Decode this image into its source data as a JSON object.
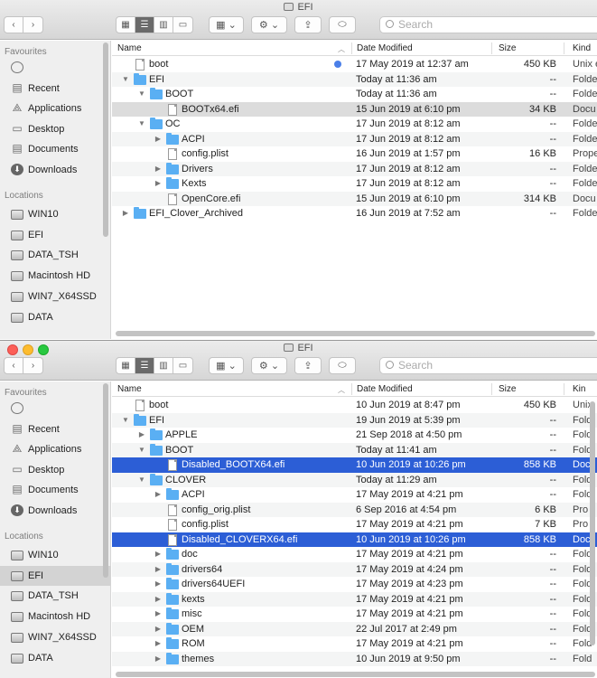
{
  "window1": {
    "title": "EFI",
    "search_placeholder": "Search",
    "sidebar": {
      "favourites_header": "Favourites",
      "favourites": [
        {
          "label": "",
          "icon": "airdrop-icon"
        },
        {
          "label": "Recent",
          "icon": "recent-icon"
        },
        {
          "label": "Applications",
          "icon": "applications-icon"
        },
        {
          "label": "Desktop",
          "icon": "desktop-icon"
        },
        {
          "label": "Documents",
          "icon": "documents-icon"
        },
        {
          "label": "Downloads",
          "icon": "downloads-icon"
        }
      ],
      "locations_header": "Locations",
      "locations": [
        {
          "label": "WIN10",
          "icon": "disk-icon"
        },
        {
          "label": "EFI",
          "icon": "disk-icon"
        },
        {
          "label": "DATA_TSH",
          "icon": "disk-icon"
        },
        {
          "label": "Macintosh HD",
          "icon": "disk-icon"
        },
        {
          "label": "WIN7_X64SSD",
          "icon": "disk-icon"
        },
        {
          "label": "DATA",
          "icon": "disk-icon"
        }
      ]
    },
    "columns": {
      "name": "Name",
      "date": "Date Modified",
      "size": "Size",
      "kind": "Kind"
    },
    "rows": [
      {
        "name": "boot",
        "date": "17 May 2019 at 12:37 am",
        "size": "450 KB",
        "kind": "Unix e",
        "depth": 0,
        "type": "file",
        "disc": "",
        "tag": true
      },
      {
        "name": "EFI",
        "date": "Today at 11:36 am",
        "size": "--",
        "kind": "Folde",
        "depth": 0,
        "type": "folder",
        "disc": "▼"
      },
      {
        "name": "BOOT",
        "date": "Today at 11:36 am",
        "size": "--",
        "kind": "Folde",
        "depth": 1,
        "type": "folder",
        "disc": "▼"
      },
      {
        "name": "BOOTx64.efi",
        "date": "15 Jun 2019 at 6:10 pm",
        "size": "34 KB",
        "kind": "Docu",
        "depth": 2,
        "type": "file",
        "disc": "",
        "selected": "grey"
      },
      {
        "name": "OC",
        "date": "17 Jun 2019 at 8:12 am",
        "size": "--",
        "kind": "Folde",
        "depth": 1,
        "type": "folder",
        "disc": "▼"
      },
      {
        "name": "ACPI",
        "date": "17 Jun 2019 at 8:12 am",
        "size": "--",
        "kind": "Folde",
        "depth": 2,
        "type": "folder",
        "disc": "▶"
      },
      {
        "name": "config.plist",
        "date": "16 Jun 2019 at 1:57 pm",
        "size": "16 KB",
        "kind": "Prope",
        "depth": 2,
        "type": "file",
        "disc": ""
      },
      {
        "name": "Drivers",
        "date": "17 Jun 2019 at 8:12 am",
        "size": "--",
        "kind": "Folde",
        "depth": 2,
        "type": "folder",
        "disc": "▶"
      },
      {
        "name": "Kexts",
        "date": "17 Jun 2019 at 8:12 am",
        "size": "--",
        "kind": "Folde",
        "depth": 2,
        "type": "folder",
        "disc": "▶"
      },
      {
        "name": "OpenCore.efi",
        "date": "15 Jun 2019 at 6:10 pm",
        "size": "314 KB",
        "kind": "Docu",
        "depth": 2,
        "type": "file",
        "disc": ""
      },
      {
        "name": "EFI_Clover_Archived",
        "date": "16 Jun 2019 at 7:52 am",
        "size": "--",
        "kind": "Folde",
        "depth": 0,
        "type": "folder",
        "disc": "▶"
      }
    ]
  },
  "window2": {
    "title": "EFI",
    "search_placeholder": "Search",
    "sidebar": {
      "favourites_header": "Favourites",
      "favourites": [
        {
          "label": "",
          "icon": "airdrop-icon"
        },
        {
          "label": "Recent",
          "icon": "recent-icon"
        },
        {
          "label": "Applications",
          "icon": "applications-icon"
        },
        {
          "label": "Desktop",
          "icon": "desktop-icon"
        },
        {
          "label": "Documents",
          "icon": "documents-icon"
        },
        {
          "label": "Downloads",
          "icon": "downloads-icon"
        }
      ],
      "locations_header": "Locations",
      "locations": [
        {
          "label": "WIN10",
          "icon": "disk-icon"
        },
        {
          "label": "EFI",
          "icon": "disk-icon",
          "selected": true
        },
        {
          "label": "DATA_TSH",
          "icon": "disk-icon"
        },
        {
          "label": "Macintosh HD",
          "icon": "disk-icon"
        },
        {
          "label": "WIN7_X64SSD",
          "icon": "disk-icon"
        },
        {
          "label": "DATA",
          "icon": "disk-icon"
        }
      ]
    },
    "columns": {
      "name": "Name",
      "date": "Date Modified",
      "size": "Size",
      "kind": "Kin"
    },
    "rows": [
      {
        "name": "boot",
        "date": "10 Jun 2019 at 8:47 pm",
        "size": "450 KB",
        "kind": "Unix",
        "depth": 0,
        "type": "file",
        "disc": ""
      },
      {
        "name": "EFI",
        "date": "19 Jun 2019 at 5:39 pm",
        "size": "--",
        "kind": "Fold",
        "depth": 0,
        "type": "folder",
        "disc": "▼"
      },
      {
        "name": "APPLE",
        "date": "21 Sep 2018 at 4:50 pm",
        "size": "--",
        "kind": "Fold",
        "depth": 1,
        "type": "folder",
        "disc": "▶"
      },
      {
        "name": "BOOT",
        "date": "Today at 11:41 am",
        "size": "--",
        "kind": "Fold",
        "depth": 1,
        "type": "folder",
        "disc": "▼"
      },
      {
        "name": "Disabled_BOOTX64.efi",
        "date": "10 Jun 2019 at 10:26 pm",
        "size": "858 KB",
        "kind": "Doc",
        "depth": 2,
        "type": "file",
        "disc": "",
        "selected": "blue"
      },
      {
        "name": "CLOVER",
        "date": "Today at 11:29 am",
        "size": "--",
        "kind": "Fold",
        "depth": 1,
        "type": "folder",
        "disc": "▼"
      },
      {
        "name": "ACPI",
        "date": "17 May 2019 at 4:21 pm",
        "size": "--",
        "kind": "Fold",
        "depth": 2,
        "type": "folder",
        "disc": "▶"
      },
      {
        "name": "config_orig.plist",
        "date": "6 Sep 2016 at 4:54 pm",
        "size": "6 KB",
        "kind": "Pro",
        "depth": 2,
        "type": "file",
        "disc": ""
      },
      {
        "name": "config.plist",
        "date": "17 May 2019 at 4:21 pm",
        "size": "7 KB",
        "kind": "Pro",
        "depth": 2,
        "type": "file",
        "disc": ""
      },
      {
        "name": "Disabled_CLOVERX64.efi",
        "date": "10 Jun 2019 at 10:26 pm",
        "size": "858 KB",
        "kind": "Doc",
        "depth": 2,
        "type": "file",
        "disc": "",
        "selected": "blue"
      },
      {
        "name": "doc",
        "date": "17 May 2019 at 4:21 pm",
        "size": "--",
        "kind": "Fold",
        "depth": 2,
        "type": "folder",
        "disc": "▶"
      },
      {
        "name": "drivers64",
        "date": "17 May 2019 at 4:24 pm",
        "size": "--",
        "kind": "Fold",
        "depth": 2,
        "type": "folder",
        "disc": "▶"
      },
      {
        "name": "drivers64UEFI",
        "date": "17 May 2019 at 4:23 pm",
        "size": "--",
        "kind": "Fold",
        "depth": 2,
        "type": "folder",
        "disc": "▶"
      },
      {
        "name": "kexts",
        "date": "17 May 2019 at 4:21 pm",
        "size": "--",
        "kind": "Fold",
        "depth": 2,
        "type": "folder",
        "disc": "▶"
      },
      {
        "name": "misc",
        "date": "17 May 2019 at 4:21 pm",
        "size": "--",
        "kind": "Fold",
        "depth": 2,
        "type": "folder",
        "disc": "▶"
      },
      {
        "name": "OEM",
        "date": "22 Jul 2017 at 2:49 pm",
        "size": "--",
        "kind": "Fold",
        "depth": 2,
        "type": "folder",
        "disc": "▶"
      },
      {
        "name": "ROM",
        "date": "17 May 2019 at 4:21 pm",
        "size": "--",
        "kind": "Fold",
        "depth": 2,
        "type": "folder",
        "disc": "▶"
      },
      {
        "name": "themes",
        "date": "10 Jun 2019 at 9:50 pm",
        "size": "--",
        "kind": "Fold",
        "depth": 2,
        "type": "folder",
        "disc": "▶"
      }
    ]
  },
  "colors": {
    "selection": "#2c5ed6",
    "folder": "#5aaff3",
    "tag_blue": "#4a7fe8"
  }
}
